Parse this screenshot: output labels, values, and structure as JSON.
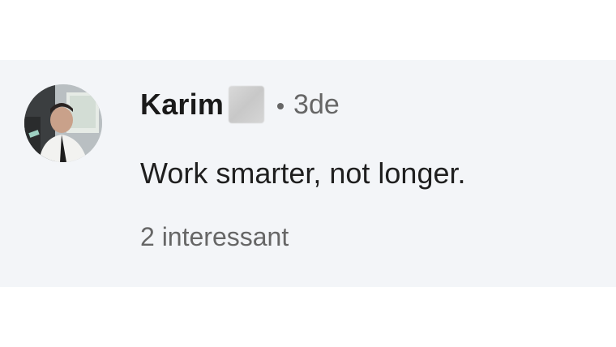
{
  "comment": {
    "author": "Karim",
    "separator": "•",
    "timestamp": "3de",
    "text": "Work smarter, not longer.",
    "reactions": "2 interessant"
  },
  "colors": {
    "card_background": "#f3f5f8",
    "primary_text": "#1a1a1a",
    "secondary_text": "#666666"
  },
  "icons": {
    "avatar": "user-photo",
    "redaction": "blurred-name-block"
  }
}
